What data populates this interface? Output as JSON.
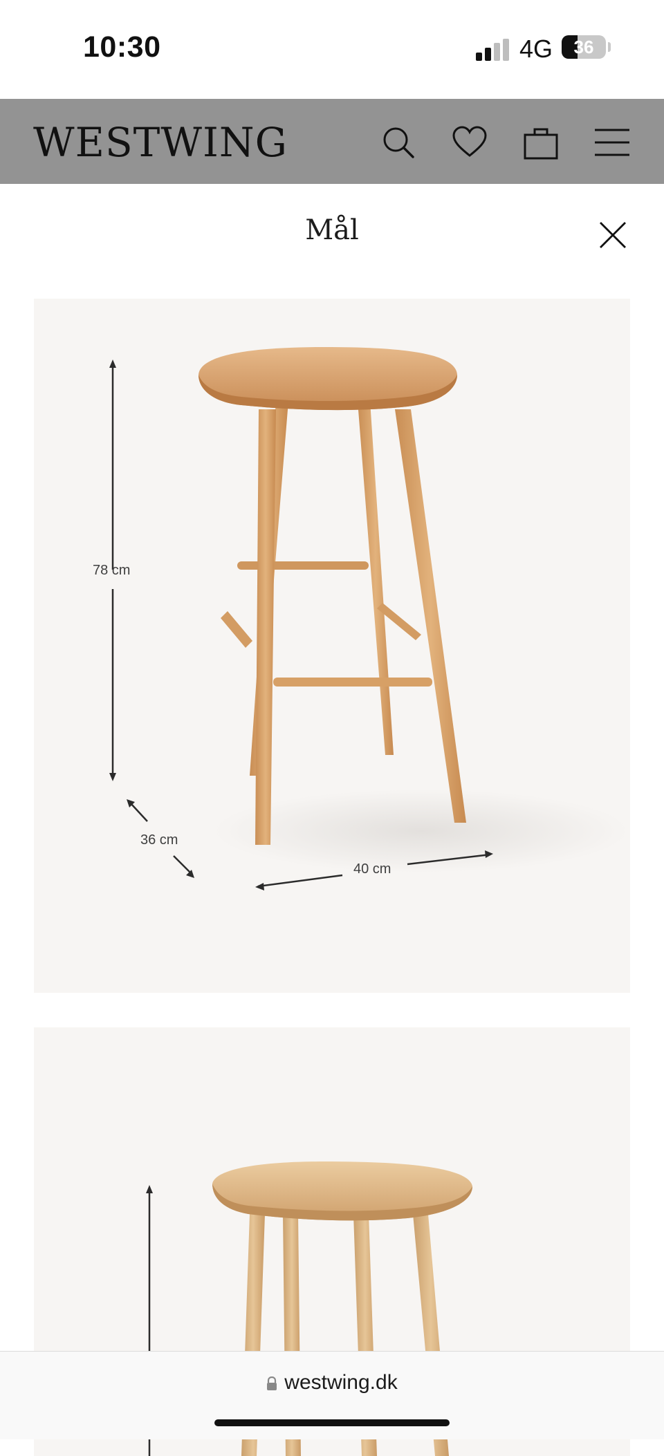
{
  "status_bar": {
    "time": "10:30",
    "network": "4G",
    "battery": "36",
    "battery_level": 0.36
  },
  "header": {
    "logo": "WESTWING",
    "icons": [
      "search-icon",
      "heart-icon",
      "bag-icon",
      "menu-icon"
    ],
    "background": "#939393"
  },
  "modal": {
    "title": "Mål",
    "close_icon": "close-icon"
  },
  "images": [
    {
      "dimensions": {
        "height": "78 cm",
        "depth": "36 cm",
        "width": "40 cm"
      }
    },
    {
      "dimensions": {}
    }
  ],
  "browser": {
    "url": "westwing.dk",
    "lock_icon": "lock-icon"
  }
}
